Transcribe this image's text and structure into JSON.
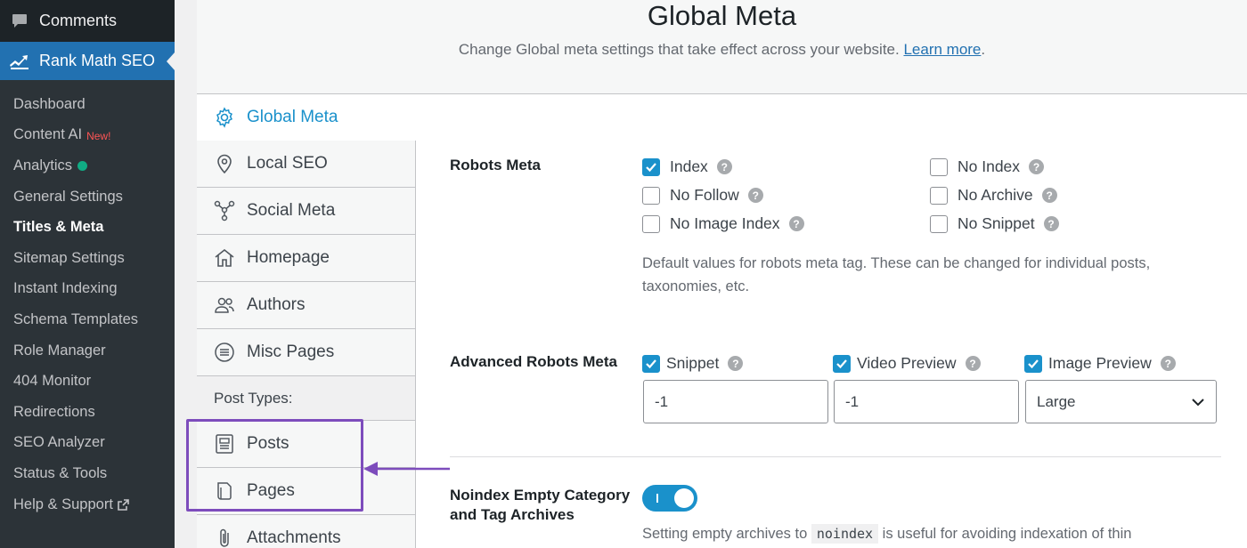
{
  "admin_menu": {
    "comments_label": "Comments",
    "rankmath_label": "Rank Math SEO",
    "items": [
      {
        "label": "Dashboard"
      },
      {
        "label": "Content AI",
        "badge": "New!"
      },
      {
        "label": "Analytics"
      },
      {
        "label": "General Settings"
      },
      {
        "label": "Titles & Meta"
      },
      {
        "label": "Sitemap Settings"
      },
      {
        "label": "Instant Indexing"
      },
      {
        "label": "Schema Templates"
      },
      {
        "label": "Role Manager"
      },
      {
        "label": "404 Monitor"
      },
      {
        "label": "Redirections"
      },
      {
        "label": "SEO Analyzer"
      },
      {
        "label": "Status & Tools"
      },
      {
        "label": "Help & Support"
      }
    ]
  },
  "header": {
    "title": "Global Meta",
    "subtitle": "Change Global meta settings that take effect across your website.",
    "learn_more": "Learn more",
    "period": "."
  },
  "tabs": {
    "global_meta": "Global Meta",
    "local_seo": "Local SEO",
    "social_meta": "Social Meta",
    "homepage": "Homepage",
    "authors": "Authors",
    "misc_pages": "Misc Pages",
    "post_types_label": "Post Types:",
    "posts": "Posts",
    "pages": "Pages",
    "attachments": "Attachments"
  },
  "robots_meta": {
    "label": "Robots Meta",
    "options": {
      "index": {
        "label": "Index",
        "checked": true
      },
      "no_index": {
        "label": "No Index",
        "checked": false
      },
      "no_follow": {
        "label": "No Follow",
        "checked": false
      },
      "no_archive": {
        "label": "No Archive",
        "checked": false
      },
      "no_image_index": {
        "label": "No Image Index",
        "checked": false
      },
      "no_snippet": {
        "label": "No Snippet",
        "checked": false
      }
    },
    "description_line1": "Default values for robots meta tag. These can be changed for individual posts,",
    "description_line2": "taxonomies, etc."
  },
  "advanced_robots": {
    "label": "Advanced Robots Meta",
    "snippet": {
      "label": "Snippet",
      "checked": true,
      "value": "-1"
    },
    "video_preview": {
      "label": "Video Preview",
      "checked": true,
      "value": "-1"
    },
    "image_preview": {
      "label": "Image Preview",
      "checked": true,
      "value": "Large"
    }
  },
  "noindex_empty": {
    "label_line1": "Noindex Empty Category",
    "label_line2": "and Tag Archives",
    "enabled": true,
    "desc_before": "Setting empty archives to",
    "desc_code": "noindex",
    "desc_after": "is useful for avoiding indexation of thin"
  },
  "help_glyph": "?",
  "colors": {
    "accent": "#1a91cb",
    "wp_blue": "#2271b1",
    "highlight": "#7d4cbc"
  }
}
